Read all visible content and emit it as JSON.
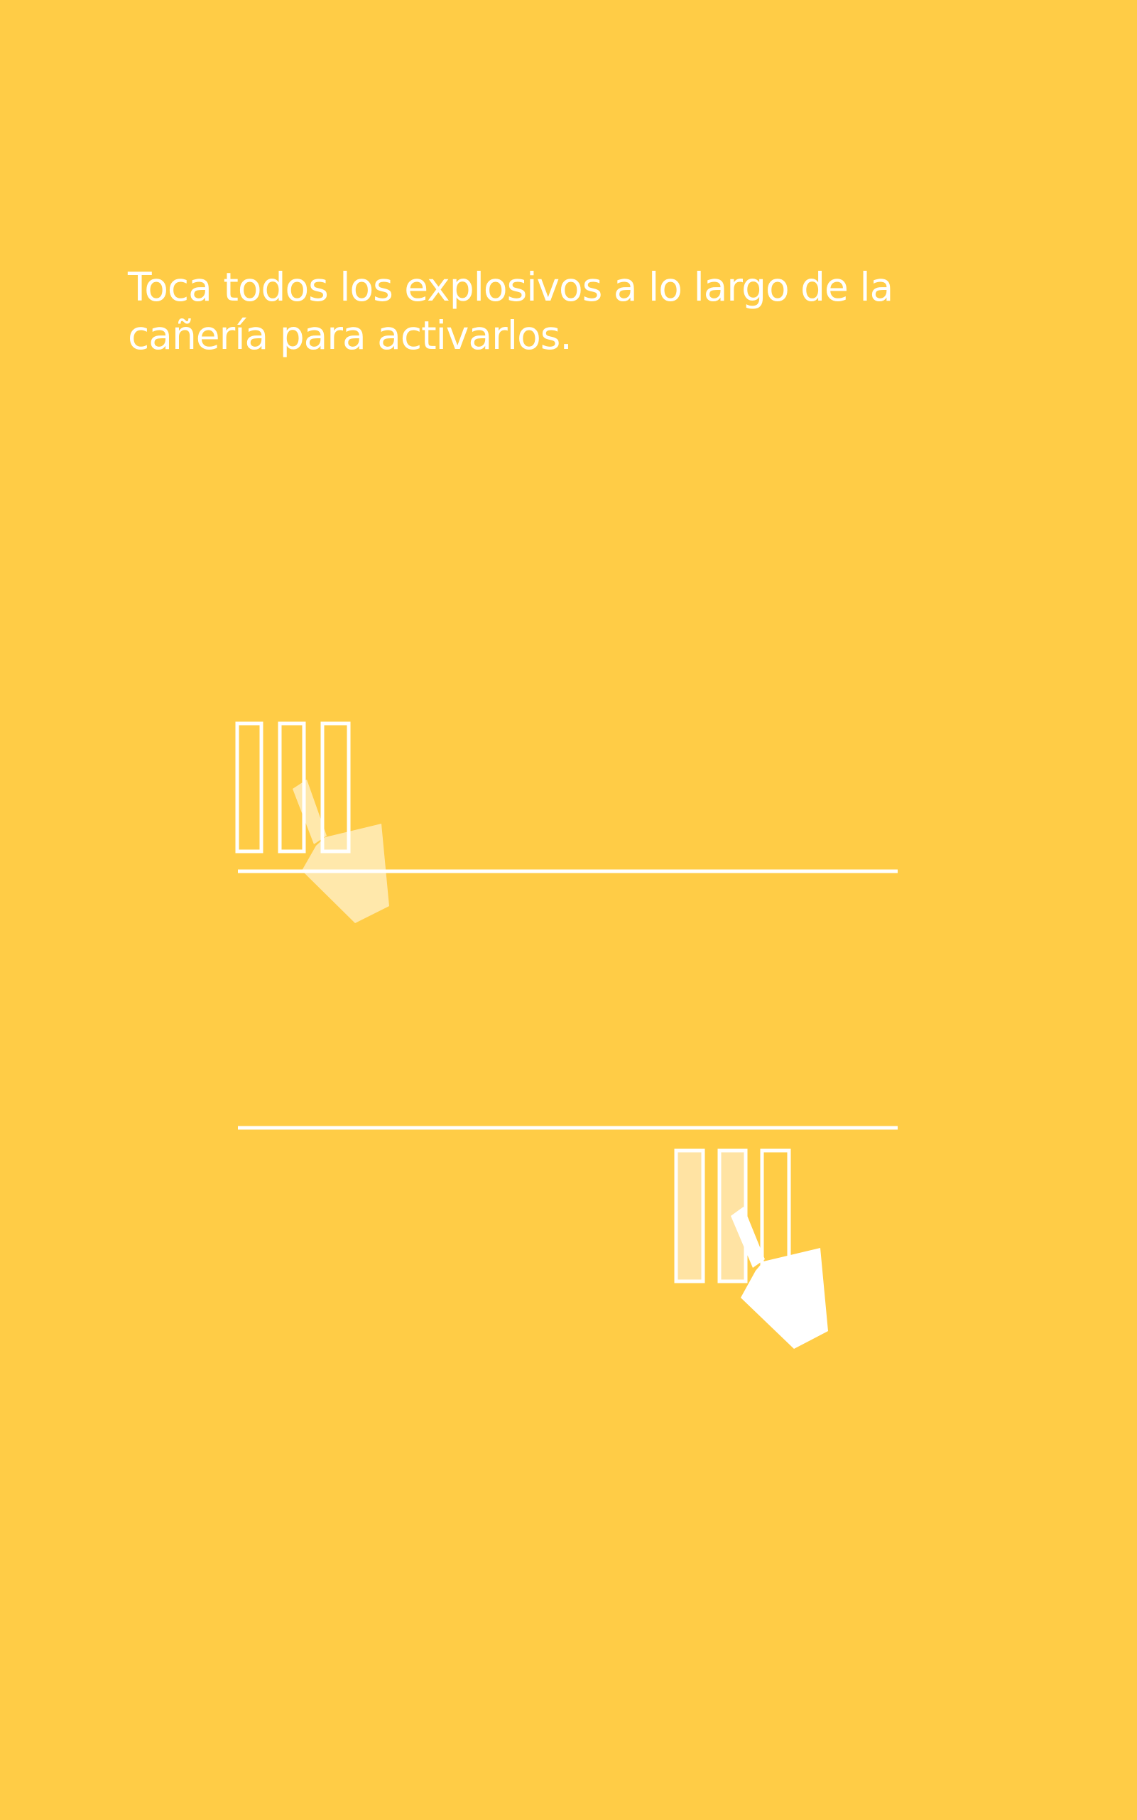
{
  "instruction": {
    "text": "Toca todos los explosivos a lo largo de la cañería para activarlos."
  },
  "colors": {
    "background": "#FFCC46",
    "foreground": "#FFFFFF",
    "faded_fill": "#FFE3A3"
  },
  "tutorial": {
    "step_1": {
      "explosive_bars": 3,
      "bars_filled": 0,
      "hand_icon": "pointing-hand-icon",
      "hand_state": "faded"
    },
    "step_2": {
      "explosive_bars": 3,
      "bars_filled": 2,
      "hand_icon": "pointing-hand-icon",
      "hand_state": "active"
    }
  }
}
